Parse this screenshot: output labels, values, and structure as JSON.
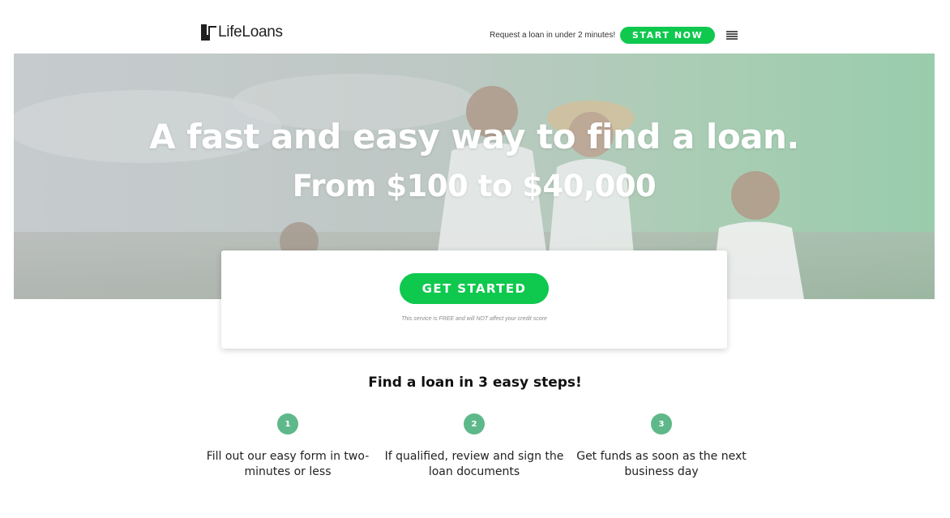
{
  "header": {
    "logo_text": "LifeLoans",
    "tagline": "Request a loan in under 2 minutes!",
    "start_now_label": "START NOW",
    "menu_icon": "hamburger-menu-icon"
  },
  "hero": {
    "title": "A fast and easy way to find a loan.",
    "subtitle": "From $100 to $40,000"
  },
  "cta": {
    "button_label": "GET STARTED",
    "disclaimer": "This service is FREE and will NOT affect your credit score"
  },
  "steps": {
    "title": "Find a loan in 3 easy steps!",
    "items": [
      {
        "number": "1",
        "text": "Fill out our easy form in two-minutes or less"
      },
      {
        "number": "2",
        "text": "If qualified, review and sign the loan documents"
      },
      {
        "number": "3",
        "text": "Get funds as soon as the next business day"
      }
    ]
  },
  "colors": {
    "accent_green": "#0fc84e",
    "step_circle": "#5fb889"
  }
}
